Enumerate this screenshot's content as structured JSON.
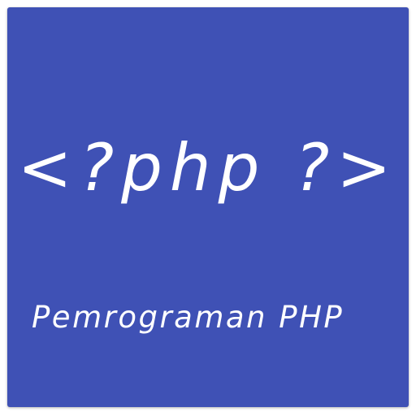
{
  "icon": {
    "code": "<?php ?>",
    "subtitle": "Pemrograman PHP"
  },
  "colors": {
    "background": "#3f51b5",
    "text": "#ffffff",
    "page": "#ffffff"
  }
}
